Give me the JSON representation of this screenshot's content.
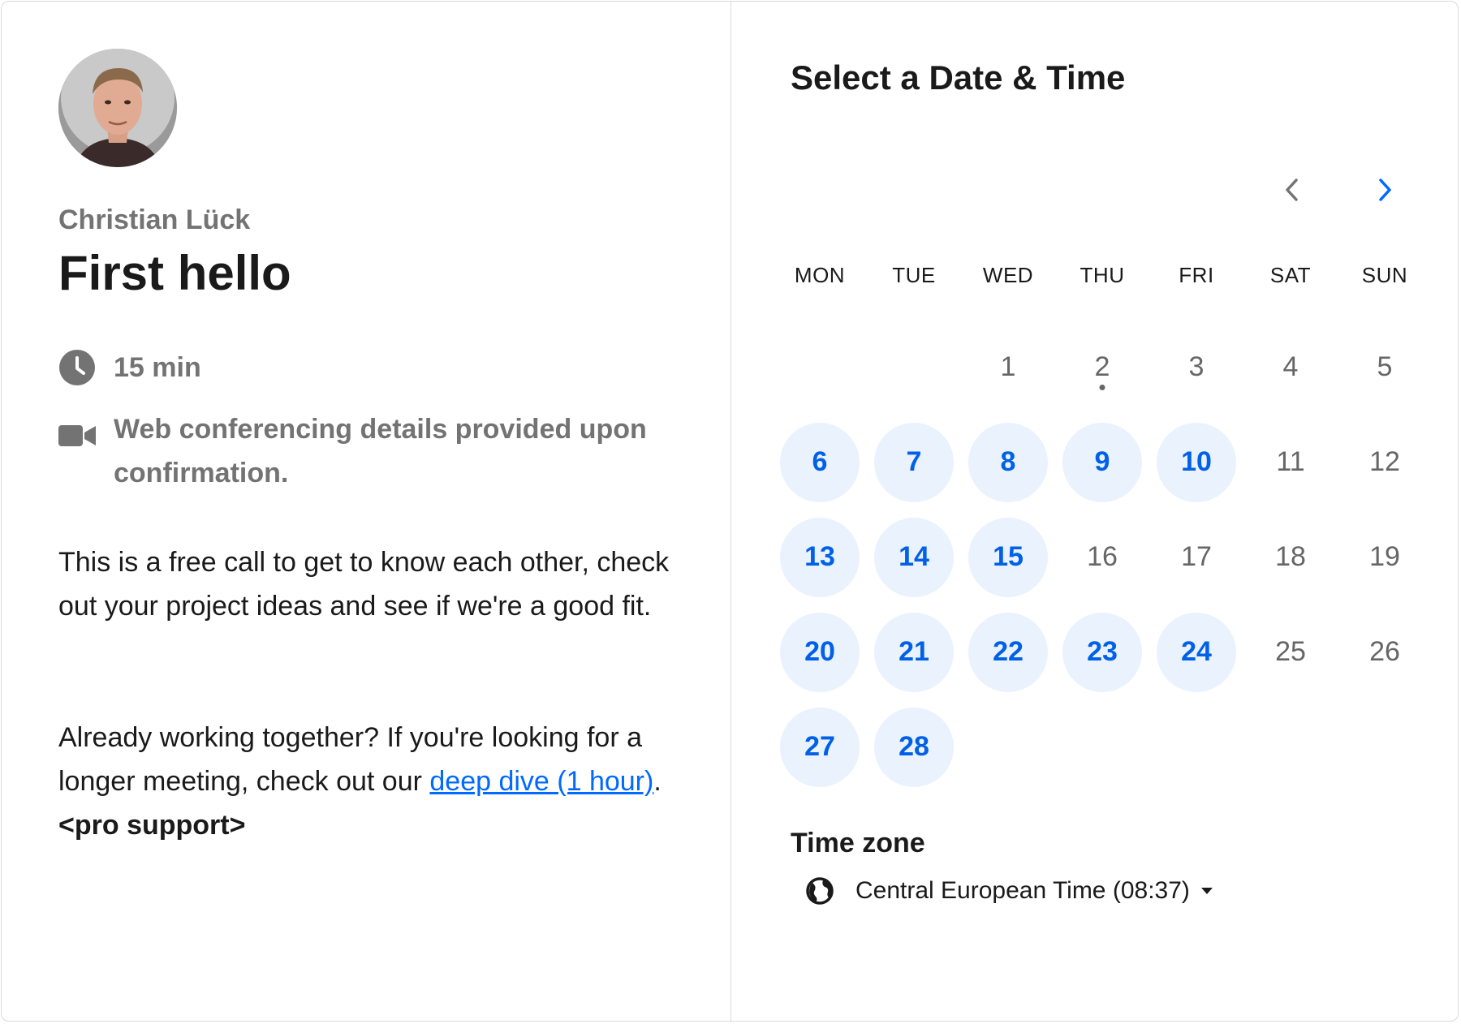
{
  "host": {
    "name": "Christian Lück"
  },
  "event": {
    "title": "First hello",
    "duration": "15 min",
    "conferencing": "Web conferencing details provided upon confirmation.",
    "description_1": "This is a free call to get to know each other, check out your project ideas and see if we're a good fit.",
    "description_2_prefix": "Already working together? If you're looking for a longer meeting, check out our ",
    "description_2_link": "deep dive (1 hour)",
    "description_2_mid": ". ",
    "description_2_bold": "<pro support>"
  },
  "calendar": {
    "title": "Select a Date & Time",
    "weekdays": [
      "MON",
      "TUE",
      "WED",
      "THU",
      "FRI",
      "SAT",
      "SUN"
    ],
    "leading_blanks": 2,
    "today": 2,
    "days": [
      {
        "n": "1",
        "available": false
      },
      {
        "n": "2",
        "available": false
      },
      {
        "n": "3",
        "available": false
      },
      {
        "n": "4",
        "available": false
      },
      {
        "n": "5",
        "available": false
      },
      {
        "n": "6",
        "available": true
      },
      {
        "n": "7",
        "available": true
      },
      {
        "n": "8",
        "available": true
      },
      {
        "n": "9",
        "available": true
      },
      {
        "n": "10",
        "available": true
      },
      {
        "n": "11",
        "available": false
      },
      {
        "n": "12",
        "available": false
      },
      {
        "n": "13",
        "available": true
      },
      {
        "n": "14",
        "available": true
      },
      {
        "n": "15",
        "available": true
      },
      {
        "n": "16",
        "available": false
      },
      {
        "n": "17",
        "available": false
      },
      {
        "n": "18",
        "available": false
      },
      {
        "n": "19",
        "available": false
      },
      {
        "n": "20",
        "available": true
      },
      {
        "n": "21",
        "available": true
      },
      {
        "n": "22",
        "available": true
      },
      {
        "n": "23",
        "available": true
      },
      {
        "n": "24",
        "available": true
      },
      {
        "n": "25",
        "available": false
      },
      {
        "n": "26",
        "available": false
      },
      {
        "n": "27",
        "available": true
      },
      {
        "n": "28",
        "available": true
      }
    ]
  },
  "timezone": {
    "label": "Time zone",
    "value": "Central European Time (08:37)"
  },
  "icons": {
    "clock": "clock-icon",
    "video": "video-camera-icon",
    "prev": "chevron-left-icon",
    "next": "chevron-right-icon",
    "globe": "globe-icon",
    "caret": "caret-down-icon"
  },
  "colors": {
    "accent": "#0069ff",
    "available_bg": "#eaf2fe",
    "available_text": "#0060e6",
    "muted": "#737373",
    "border": "#dadada"
  }
}
